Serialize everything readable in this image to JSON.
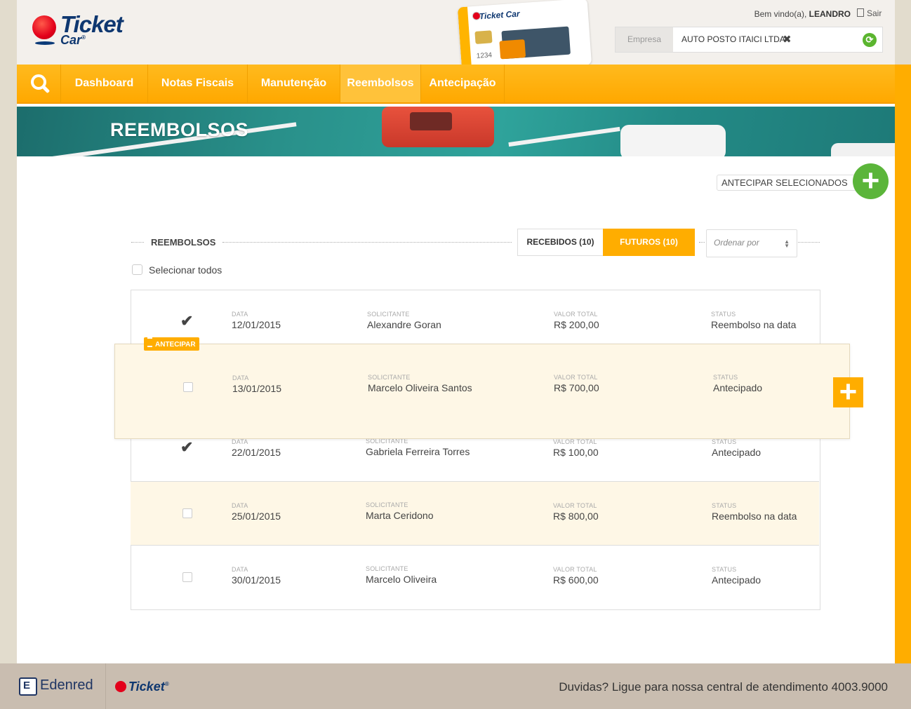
{
  "brand": {
    "logo_line1": "Ticket",
    "logo_line2": "Car",
    "reg": "®"
  },
  "card": {
    "brand": "Ticket Car",
    "number": "1234"
  },
  "user": {
    "welcome": "Bem vindo(a),",
    "name": "LEANDRO",
    "logout": "Sair"
  },
  "company": {
    "label": "Empresa",
    "value": "AUTO POSTO ITAICI LTDA -"
  },
  "nav": {
    "items": [
      {
        "label": "Dashboard",
        "active": false
      },
      {
        "label": "Notas Fiscais",
        "active": false
      },
      {
        "label": "Manutenção",
        "active": false
      },
      {
        "label": "Reembolsos",
        "active": true
      },
      {
        "label": "Antecipação",
        "active": false
      }
    ]
  },
  "banner": {
    "title": "REEMBOLSOS"
  },
  "actions": {
    "advance_selected": "ANTECIPAR SELECIONADOS"
  },
  "section": {
    "title": "REEMBOLSOS",
    "tabs": [
      {
        "label": "RECEBIDOS (10)",
        "active": false
      },
      {
        "label": "FUTUROS (10)",
        "active": true
      }
    ],
    "order_placeholder": "Ordenar por",
    "select_all": "Selecionar todos"
  },
  "columns": {
    "date": "DATA",
    "requester": "SOLICITANTE",
    "total": "VALOR TOTAL",
    "status": "STATUS"
  },
  "rows": [
    {
      "date": "12/01/2015",
      "requester": "Alexandre Goran",
      "total": "R$ 200,00",
      "status": "Reembolso na data",
      "checked": true
    },
    {
      "date": "13/01/2015",
      "requester": "Marcelo Oliveira Santos",
      "total": "R$ 700,00",
      "status": "Antecipado",
      "checked": false,
      "badge": "ANTECIPAR"
    },
    {
      "date": "22/01/2015",
      "requester": "Gabriela Ferreira Torres",
      "total": "R$ 100,00",
      "status": "Antecipado",
      "checked": true
    },
    {
      "date": "25/01/2015",
      "requester": "Marta Ceridono",
      "total": "R$ 800,00",
      "status": "Reembolso na data",
      "checked": false
    },
    {
      "date": "30/01/2015",
      "requester": "Marcelo Oliveira",
      "total": "R$ 600,00",
      "status": "Antecipado",
      "checked": false
    }
  ],
  "footer": {
    "edenred": "Edenred",
    "ticket": "Ticket",
    "reg": "®",
    "help": "Duvidas? Ligue para nossa central de atendimento 4003.9000"
  },
  "colors": {
    "accent": "#ffad00",
    "green": "#5bb53a",
    "navy": "#0e3770",
    "highlight_row": "#fef7e6"
  }
}
